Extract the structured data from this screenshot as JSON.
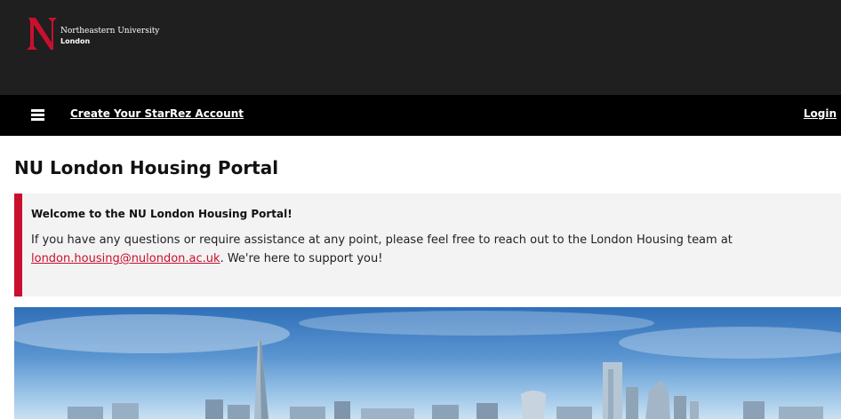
{
  "header": {
    "logo_line1": "Northeastern University",
    "logo_line2": "London",
    "brand_color": "#c8102e"
  },
  "nav": {
    "menu_icon": "hamburger-menu-icon",
    "create_account": "Create Your StarRez Account",
    "login": "Login"
  },
  "page": {
    "title": "NU London Housing Portal"
  },
  "alert": {
    "heading": "Welcome to the NU London Housing Portal!",
    "body_before": "If you have any questions or require assistance at any point, please feel free to reach out to the London Housing team at ",
    "email": "london.housing@nulondon.ac.uk",
    "body_after": ". We're here to support you!"
  },
  "hero": {
    "image": "london-skyline-image"
  }
}
